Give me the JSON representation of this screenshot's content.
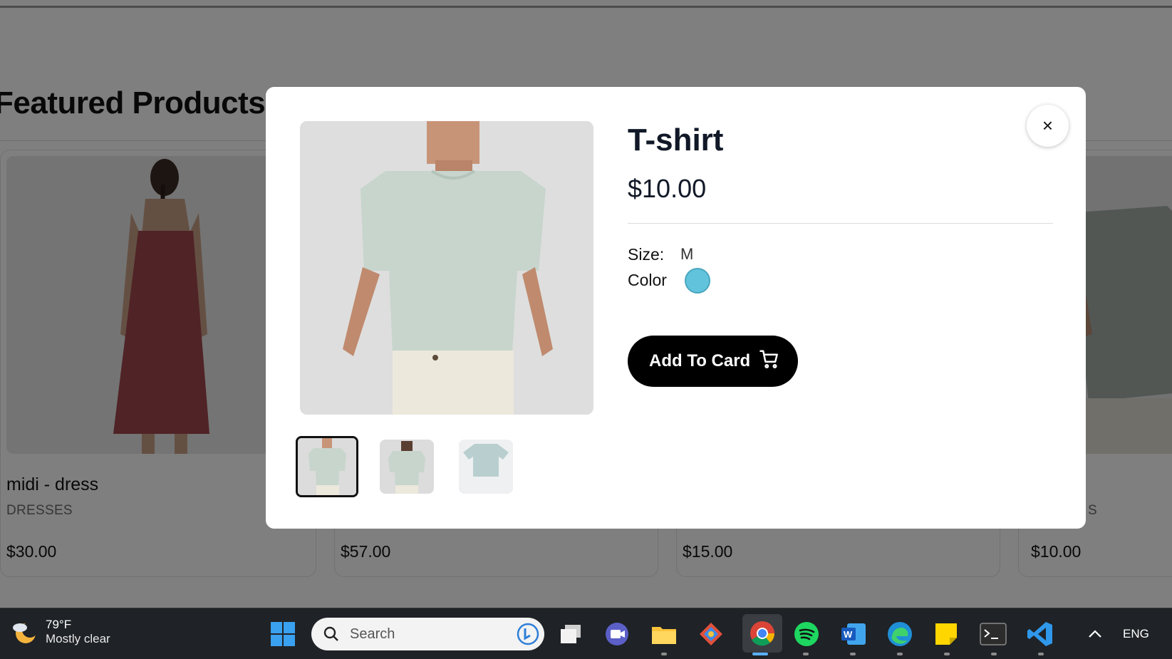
{
  "page": {
    "section_title": "Featured Products",
    "products": [
      {
        "name": "midi - dress",
        "category": "DRESSES",
        "price": "$30.00"
      },
      {
        "name": "",
        "category": "",
        "price": "$57.00"
      },
      {
        "name": "",
        "category": "",
        "price": "$15.00"
      },
      {
        "name": "",
        "category": "S",
        "price": "$10.00"
      }
    ]
  },
  "modal": {
    "title": "T-shirt",
    "price": "$10.00",
    "size_label": "Size:",
    "size_value": "M",
    "color_label": "Color",
    "color_value": "#62c3dd",
    "add_button_label": "Add To Card",
    "close_icon": "×",
    "thumbnails": [
      "front",
      "back",
      "flat"
    ]
  },
  "taskbar": {
    "weather_temp": "79°F",
    "weather_desc": "Mostly clear",
    "search_placeholder": "Search",
    "language": "ENG"
  }
}
